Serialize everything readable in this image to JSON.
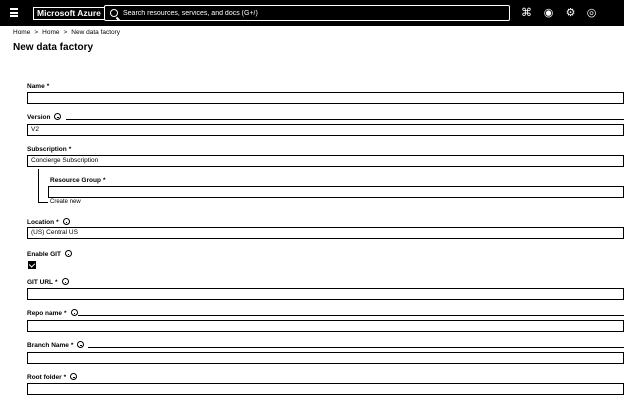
{
  "topbar": {
    "brand": "Microsoft Azure",
    "search_placeholder": "Search resources, services, and docs (G+/)"
  },
  "breadcrumb": {
    "items": [
      "Home",
      "Home",
      "New data factory"
    ]
  },
  "page_title": "New data factory",
  "form": {
    "name": {
      "label": "Name",
      "required": "*",
      "value": ""
    },
    "version": {
      "label": "Version",
      "value": "V2"
    },
    "subscription": {
      "label": "Subscription",
      "required": "*",
      "value": "Concierge Subscription"
    },
    "resource_group": {
      "label": "Resource Group",
      "required": "*",
      "value": "",
      "create_new": "Create new"
    },
    "location": {
      "label": "Location",
      "required": "*",
      "value": "(US) Central US"
    },
    "enable_git": {
      "label": "Enable GIT",
      "checked": true
    },
    "git_url": {
      "label": "GIT URL",
      "required": "*",
      "value": ""
    },
    "repo_name": {
      "label": "Repo name",
      "required": "*",
      "value": ""
    },
    "branch_name": {
      "label": "Branch Name",
      "required": "*",
      "value": ""
    },
    "root_folder": {
      "label": "Root folder",
      "required": "*",
      "value": ""
    }
  }
}
